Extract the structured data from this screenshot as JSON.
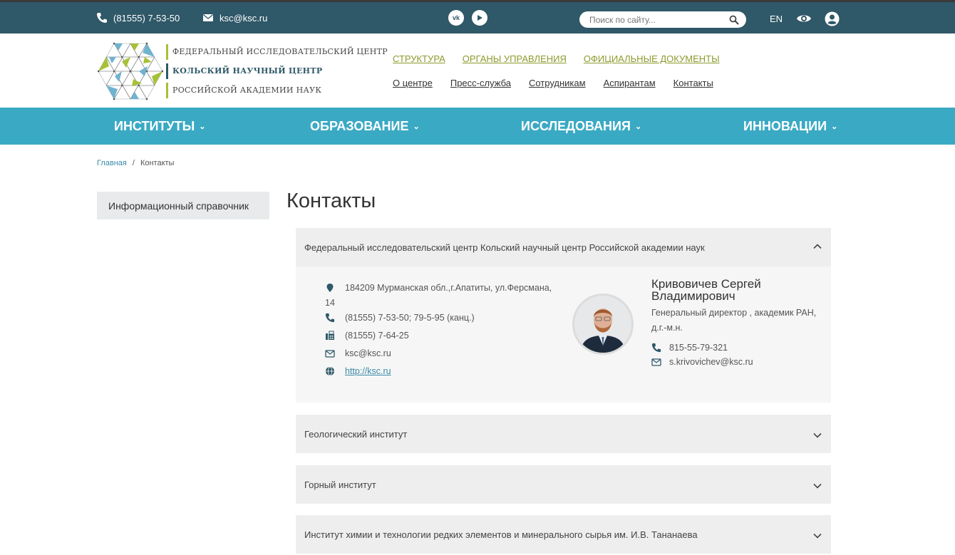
{
  "topbar": {
    "phone": "(81555) 7-53-50",
    "email": "ksc@ksc.ru",
    "search_placeholder": "Поиск по сайту...",
    "lang": "EN",
    "social": [
      "vk-icon",
      "youtube-icon"
    ]
  },
  "logo": {
    "line1": "Федеральный исследовательский центр",
    "line2": "Кольский научный центр",
    "line3": "Российской академии наук"
  },
  "main_links": [
    "СТРУКТУРА",
    "ОРГАНЫ УПРАВЛЕНИЯ",
    "ОФИЦИАЛЬНЫЕ ДОКУМЕНТЫ"
  ],
  "sub_links": [
    "О центре",
    "Пресс-служба",
    "Сотрудникам",
    "Аспирантам",
    "Контакты"
  ],
  "nav": [
    "ИНСТИТУТЫ",
    "ОБРАЗОВАНИЕ",
    "ИССЛЕДОВАНИЯ",
    "ИННОВАЦИИ"
  ],
  "breadcrumb": {
    "home": "Главная",
    "sep": "/",
    "current": "Контакты"
  },
  "sidebar": {
    "item": "Информационный справочник"
  },
  "page_title": "Контакты",
  "accordion": [
    {
      "title": "Федеральный исследовательский центр Кольский научный центр Российской академии наук",
      "expanded": true,
      "address_line1": "184209 Мурманская обл.,г.Апатиты, ул.Ферсмана,",
      "address_line2": "14",
      "phone": "(81555) 7-53-50; 79-5-95 (канц.)",
      "fax": "(81555) 7-64-25",
      "email": "ksc@ksc.ru",
      "site": "http://ksc.ru",
      "person": {
        "name_line1": "Кривовичев Сергей",
        "name_line2": "Владимирович",
        "position_line1": "Генеральный директор , академик РАН,",
        "position_line2": "д.г.-м.н.",
        "phone": "815-55-79-321",
        "email": "s.krivovichev@ksc.ru"
      }
    },
    {
      "title": "Геологический институт",
      "expanded": false
    },
    {
      "title": "Горный институт",
      "expanded": false
    },
    {
      "title": "Институт химии и технологии редких элементов и минерального сырья им. И.В. Тананаева",
      "expanded": false
    }
  ],
  "colors": {
    "topbar": "#2f5868",
    "nav": "#3aa9c4",
    "link_green": "#8c9b2d",
    "link_blue": "#3a8aa8"
  }
}
